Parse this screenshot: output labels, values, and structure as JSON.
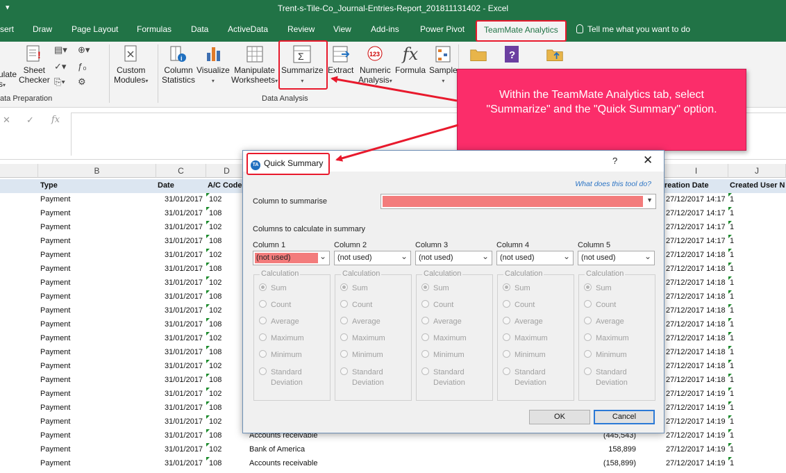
{
  "window": {
    "title": "Trent-s-Tile-Co_Journal-Entries-Report_201811131402  -  Excel",
    "qat_icon": "customize-qat-icon"
  },
  "tabs": {
    "insert": "sert",
    "draw": "Draw",
    "page_layout": "Page Layout",
    "formulas": "Formulas",
    "data": "Data",
    "activedata": "ActiveData",
    "review": "Review",
    "view": "View",
    "addins": "Add-ins",
    "power_pivot": "Power Pivot",
    "teammate": "TeamMate Analytics",
    "tell_me": "Tell me what you want to do"
  },
  "ribbon": {
    "calculate": [
      "ulate",
      "s"
    ],
    "sheet_checker": [
      "Sheet",
      "Checker"
    ],
    "custom_modules": [
      "Custom",
      "Modules"
    ],
    "column_statistics": [
      "Column",
      "Statistics"
    ],
    "visualize": "Visualize",
    "manipulate": [
      "Manipulate",
      "Worksheets"
    ],
    "summarize": "Summarize",
    "extract": "Extract",
    "numeric": [
      "Numeric",
      "Analysis"
    ],
    "formula": "Formula",
    "sample": "Sample",
    "group_data_prep": "ata Preparation",
    "group_data_analysis": "Data Analysis",
    "fx_label": "fx",
    "cancel_glyph": "✕",
    "enter_glyph": "✓"
  },
  "grid": {
    "columns": [
      "B",
      "C",
      "D",
      "I",
      "J"
    ],
    "headers": {
      "type": "Type",
      "date": "Date",
      "ac": "A/C Code",
      "creation": "reation Date",
      "user": "Created User N"
    },
    "rows": [
      {
        "type": "Payment",
        "date": "31/01/2017",
        "ac": "102",
        "desc": "",
        "amt": "",
        "cdate": "27/12/2017 14:17",
        "u": "1"
      },
      {
        "type": "Payment",
        "date": "31/01/2017",
        "ac": "108",
        "desc": "",
        "amt": "",
        "cdate": "27/12/2017 14:17",
        "u": "1"
      },
      {
        "type": "Payment",
        "date": "31/01/2017",
        "ac": "102",
        "desc": "",
        "amt": "",
        "cdate": "27/12/2017 14:17",
        "u": "1"
      },
      {
        "type": "Payment",
        "date": "31/01/2017",
        "ac": "108",
        "desc": "",
        "amt": "",
        "cdate": "27/12/2017 14:17",
        "u": "1"
      },
      {
        "type": "Payment",
        "date": "31/01/2017",
        "ac": "102",
        "desc": "",
        "amt": "",
        "cdate": "27/12/2017 14:18",
        "u": "1"
      },
      {
        "type": "Payment",
        "date": "31/01/2017",
        "ac": "108",
        "desc": "",
        "amt": "",
        "cdate": "27/12/2017 14:18",
        "u": "1"
      },
      {
        "type": "Payment",
        "date": "31/01/2017",
        "ac": "102",
        "desc": "",
        "amt": "",
        "cdate": "27/12/2017 14:18",
        "u": "1"
      },
      {
        "type": "Payment",
        "date": "31/01/2017",
        "ac": "108",
        "desc": "",
        "amt": "",
        "cdate": "27/12/2017 14:18",
        "u": "1"
      },
      {
        "type": "Payment",
        "date": "31/01/2017",
        "ac": "102",
        "desc": "",
        "amt": "",
        "cdate": "27/12/2017 14:18",
        "u": "1"
      },
      {
        "type": "Payment",
        "date": "31/01/2017",
        "ac": "108",
        "desc": "",
        "amt": "",
        "cdate": "27/12/2017 14:18",
        "u": "1"
      },
      {
        "type": "Payment",
        "date": "31/01/2017",
        "ac": "102",
        "desc": "",
        "amt": "",
        "cdate": "27/12/2017 14:18",
        "u": "1"
      },
      {
        "type": "Payment",
        "date": "31/01/2017",
        "ac": "108",
        "desc": "",
        "amt": "",
        "cdate": "27/12/2017 14:18",
        "u": "1"
      },
      {
        "type": "Payment",
        "date": "31/01/2017",
        "ac": "102",
        "desc": "",
        "amt": "",
        "cdate": "27/12/2017 14:18",
        "u": "1"
      },
      {
        "type": "Payment",
        "date": "31/01/2017",
        "ac": "108",
        "desc": "",
        "amt": "",
        "cdate": "27/12/2017 14:18",
        "u": "1"
      },
      {
        "type": "Payment",
        "date": "31/01/2017",
        "ac": "102",
        "desc": "",
        "amt": "",
        "cdate": "27/12/2017 14:19",
        "u": "1"
      },
      {
        "type": "Payment",
        "date": "31/01/2017",
        "ac": "108",
        "desc": "",
        "amt": "",
        "cdate": "27/12/2017 14:19",
        "u": "1"
      },
      {
        "type": "Payment",
        "date": "31/01/2017",
        "ac": "102",
        "desc": "",
        "amt": "",
        "cdate": "27/12/2017 14:19",
        "u": "1"
      },
      {
        "type": "Payment",
        "date": "31/01/2017",
        "ac": "108",
        "desc": "Accounts receivable",
        "amt": "(445,543)",
        "cdate": "27/12/2017 14:19",
        "u": "1"
      },
      {
        "type": "Payment",
        "date": "31/01/2017",
        "ac": "102",
        "desc": "Bank of America",
        "amt": "158,899",
        "cdate": "27/12/2017 14:19",
        "u": "1"
      },
      {
        "type": "Payment",
        "date": "31/01/2017",
        "ac": "108",
        "desc": "Accounts receivable",
        "amt": "(158,899)",
        "cdate": "27/12/2017 14:19",
        "u": "1"
      }
    ]
  },
  "dialog": {
    "title": "Quick Summary",
    "logo_text": "TA",
    "help": "?",
    "close": "✕",
    "help_link": "What does this tool do?",
    "column_to_summarise_label": "Column to summarise",
    "columns_calc_label": "Columns to calculate in summary",
    "columns": [
      {
        "label": "Column 1",
        "value": "(not used)"
      },
      {
        "label": "Column 2",
        "value": "(not used)"
      },
      {
        "label": "Column 3",
        "value": "(not used)"
      },
      {
        "label": "Column 4",
        "value": "(not used)"
      },
      {
        "label": "Column 5",
        "value": "(not used)"
      }
    ],
    "calculation_legend": "Calculation",
    "options": [
      "Sum",
      "Count",
      "Average",
      "Maximum",
      "Minimum"
    ],
    "std_dev": [
      "Standard",
      "Deviation"
    ],
    "ok": "OK",
    "cancel": "Cancel"
  },
  "callout": {
    "text": "Within the TeamMate Analytics tab, select \"Summarize\" and the \"Quick Summary\" option."
  },
  "colors": {
    "excel_green": "#217346",
    "callout": "#fb2d6a",
    "highlight_red": "#e8192c",
    "required_field": "#f37c7c"
  }
}
